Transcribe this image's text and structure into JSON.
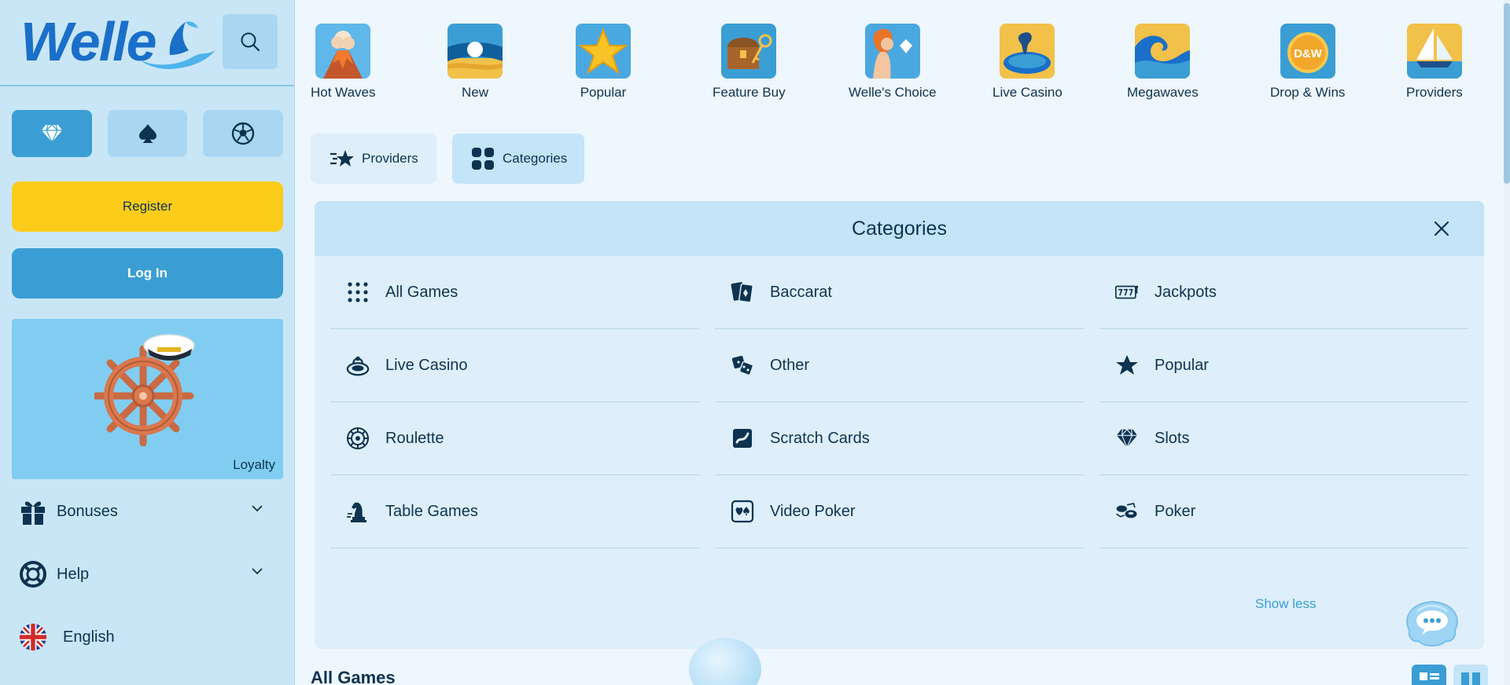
{
  "sidebar": {
    "logo_text": "Welle",
    "register_label": "Register",
    "login_label": "Log In",
    "loyalty_label": "Loyalty",
    "items": [
      {
        "label": "Bonuses",
        "icon": "gift-icon"
      },
      {
        "label": "Help",
        "icon": "lifebuoy-icon"
      },
      {
        "label": "English",
        "icon": "uk-flag-icon"
      }
    ]
  },
  "top_categories": [
    {
      "label": "Hot Waves",
      "icon": "volcano-icon"
    },
    {
      "label": "New",
      "icon": "sunrise-icon"
    },
    {
      "label": "Popular",
      "icon": "starfish-icon"
    },
    {
      "label": "Feature Buy",
      "icon": "treasure-chest-icon"
    },
    {
      "label": "Welle's Choice",
      "icon": "mermaid-icon"
    },
    {
      "label": "Live Casino",
      "icon": "seahorse-table-icon"
    },
    {
      "label": "Megawaves",
      "icon": "wave-icon"
    },
    {
      "label": "Drop & Wins",
      "icon": "drop-wins-icon"
    },
    {
      "label": "Providers",
      "icon": "sailboat-icon"
    }
  ],
  "drop_wins_badge": "D&W",
  "tabs": {
    "providers": "Providers",
    "categories": "Categories"
  },
  "panel": {
    "title": "Categories",
    "show_less": "Show less",
    "items": [
      {
        "label": "All Games",
        "icon": "dots-grid-icon"
      },
      {
        "label": "Baccarat",
        "icon": "cards-icon"
      },
      {
        "label": "Jackpots",
        "icon": "jackpot-777-icon"
      },
      {
        "label": "Live Casino",
        "icon": "live-casino-icon"
      },
      {
        "label": "Other",
        "icon": "dice-icon"
      },
      {
        "label": "Popular",
        "icon": "star-icon"
      },
      {
        "label": "Roulette",
        "icon": "roulette-icon"
      },
      {
        "label": "Scratch Cards",
        "icon": "scratch-card-icon"
      },
      {
        "label": "Slots",
        "icon": "diamond-icon"
      },
      {
        "label": "Table Games",
        "icon": "chess-knight-icon"
      },
      {
        "label": "Video Poker",
        "icon": "video-poker-icon"
      },
      {
        "label": "Poker",
        "icon": "poker-chips-icon"
      }
    ]
  },
  "section_title": "All Games",
  "colors": {
    "accent": "#3a9ed4",
    "register": "#fccc1a",
    "sidebar_bg": "#c9e6f6",
    "text": "#0d3350"
  }
}
